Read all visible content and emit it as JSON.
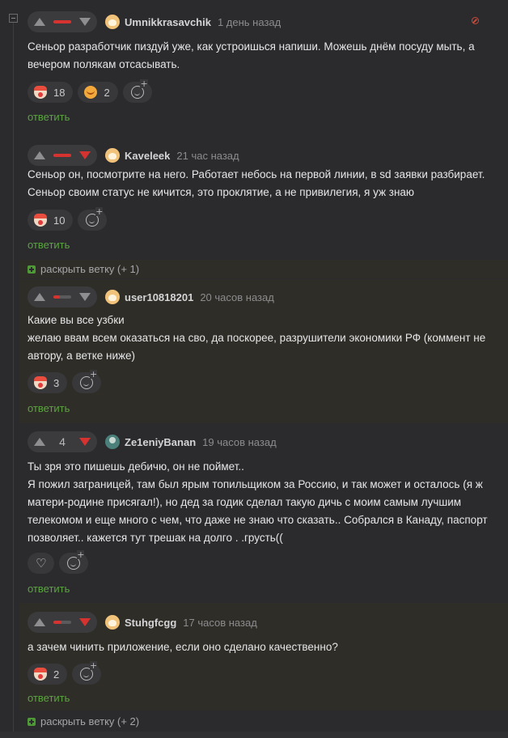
{
  "reply_label": "ответить",
  "comments": [
    {
      "author": "Umnikkrasavchik",
      "time": "1 день назад",
      "rating_bar_red_fraction": 1.0,
      "text": [
        "Сеньор разработчик пиздуй уже, как устроишься напиши. Можешь днём посуду мыть, а",
        "вечером полякам отсасывать."
      ],
      "reactions": [
        {
          "icon": "clown-face-icon",
          "count": "18"
        },
        {
          "icon": "smiling-face-icon",
          "count": "2"
        }
      ]
    },
    {
      "author": "Kaveleek",
      "time": "21 час назад",
      "rating_bar_red_fraction": 1.0,
      "text": [
        "Сеньор он, посмотрите на него. Работает небось на первой линии, в sd заявки разбирает.",
        "Сеньор своим статус не кичится, это проклятие, а не привилегия, я уж знаю"
      ],
      "reactions": [
        {
          "icon": "clown-face-icon",
          "count": "10"
        }
      ]
    },
    {
      "author": "user10818201",
      "time": "20 часов назад",
      "rating_bar_red_fraction": 0.35,
      "text": [
        "Какие вы все узбки",
        "желаю ввам всем оказаться на сво, да поскорее, разрушители экономики РФ (коммент не",
        "автору, а ветке ниже)"
      ],
      "reactions": [
        {
          "icon": "clown-face-icon",
          "count": "3"
        }
      ]
    },
    {
      "author": "Ze1eniyBanan",
      "time": "19 часов назад",
      "rating": "4",
      "text": [
        "Ты зря это пишешь дебичю, он не поймет..",
        "Я пожил заграницей, там был ярым топильщиком за Россию, и так может и осталось (я ж",
        "матери-родине присягал!), но дед за годик сделал такую дичь с моим самым лучшим",
        "телекомом и еще много с чем, что даже не знаю что сказать.. Собрался в Канаду, паспорт",
        "позволяет.. кажется тут трешак на долго . .грусть(("
      ]
    },
    {
      "author": "Stuhgfcgg",
      "time": "17 часов назад",
      "rating_bar_red_fraction": 0.45,
      "text": [
        "а зачем чинить приложение, если оно сделано качественно?"
      ],
      "reactions": [
        {
          "icon": "clown-face-icon",
          "count": "2"
        }
      ]
    }
  ],
  "expand_threads": [
    {
      "label": "раскрыть ветку (+ 1)"
    },
    {
      "label": "раскрыть ветку (+ 2)"
    }
  ]
}
